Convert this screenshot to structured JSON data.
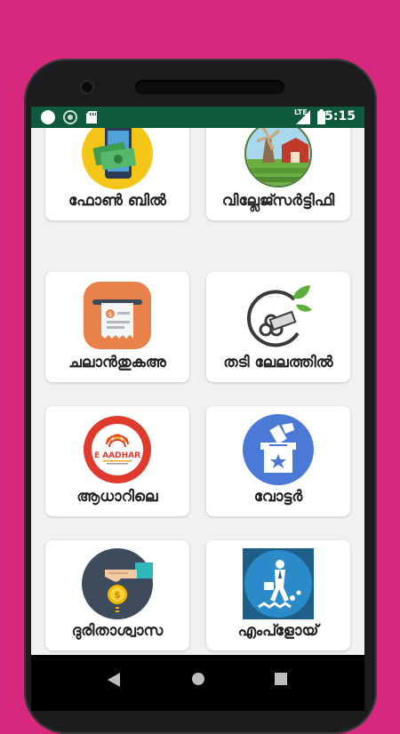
{
  "status": {
    "time": "5:15",
    "network": "LTE",
    "icons": [
      "circle-icon",
      "sync-icon",
      "sd-card-icon",
      "signal-icon",
      "battery-icon"
    ]
  },
  "services": [
    {
      "label": "ഫോൺ ബിൽ",
      "icon": "phone-bill-icon"
    },
    {
      "label": "വില്ലേജ്സർട്ടിഫി",
      "icon": "village-certificate-icon"
    },
    {
      "label": "ചലാൻതുകഅ",
      "icon": "challan-receipt-icon"
    },
    {
      "label": "തടി ലേലത്തിൽ",
      "icon": "timber-auction-icon"
    },
    {
      "label": "ആധാറിലെ",
      "icon": "aadhaar-icon"
    },
    {
      "label": "വോട്ടർ",
      "icon": "voter-ballot-icon"
    },
    {
      "label": "ദുരിതാശ്വാസ",
      "icon": "relief-fund-icon"
    },
    {
      "label": "എംപ്ളോയ്",
      "icon": "employment-icon"
    }
  ],
  "nav": [
    "back-icon",
    "home-icon",
    "recents-icon"
  ],
  "colors": {
    "background": "#D8287E",
    "status_bar": "#0E5A3C",
    "card": "#FFFFFF"
  }
}
